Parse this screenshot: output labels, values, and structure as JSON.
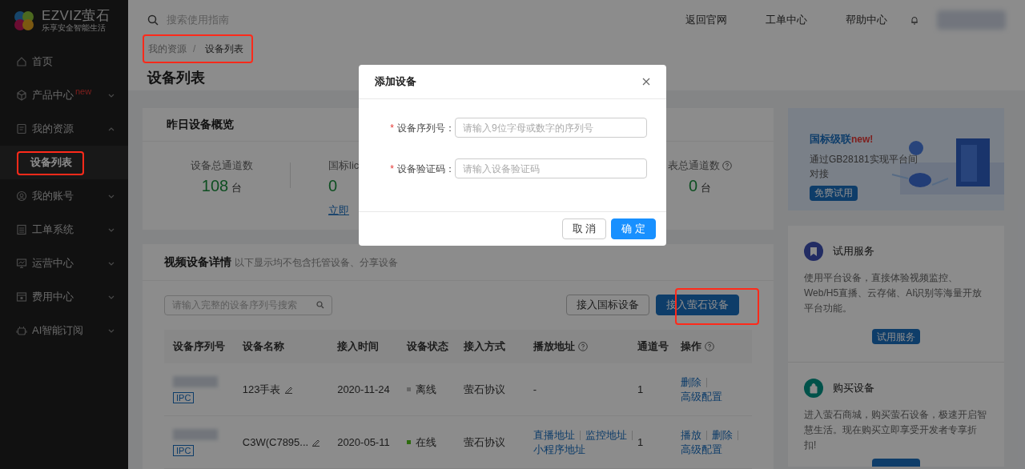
{
  "logo": {
    "brand": "EZVIZ萤石",
    "tagline": "乐享安全智能生活"
  },
  "sidebar": {
    "items": [
      {
        "label": "首页"
      },
      {
        "label": "产品中心",
        "badge": "new",
        "expanded": false
      },
      {
        "label": "我的资源",
        "expanded": true,
        "children": [
          {
            "label": "设备列表",
            "selected": true
          }
        ]
      },
      {
        "label": "我的账号",
        "expanded": false
      },
      {
        "label": "工单系统",
        "expanded": false
      },
      {
        "label": "运营中心",
        "expanded": false
      },
      {
        "label": "费用中心",
        "expanded": false
      },
      {
        "label": "AI智能订阅",
        "expanded": false
      }
    ]
  },
  "header": {
    "search_placeholder": "搜索使用指南",
    "links": [
      "返回官网",
      "工单中心",
      "帮助中心"
    ]
  },
  "breadcrumb": {
    "items": [
      "我的资源",
      "设备列表"
    ],
    "separator": "/"
  },
  "page_title": "设备列表",
  "overview": {
    "title": "昨日设备概览",
    "stats": [
      {
        "label": "设备总通道数",
        "value": "108",
        "unit": "台"
      },
      {
        "label": "国标lic",
        "value": "0",
        "link": "立即"
      },
      {
        "label": "表总通道数",
        "value": "0",
        "unit": "台",
        "help": true
      }
    ]
  },
  "banner": {
    "title": "国标级联",
    "badge": "new!",
    "text": "通过GB28181实现平台间对接",
    "button": "免费试用"
  },
  "promos": [
    {
      "title": "试用服务",
      "text": "使用平台设备，直接体验视频监控、Web/H5直播、云存储、AI识别等海量开放平台功能。",
      "button": "试用服务"
    },
    {
      "title": "购买设备",
      "text": "进入萤石商城，购买萤石设备，极速开启智慧生活。现在购买立即享受开发者专享折扣!"
    }
  ],
  "details": {
    "title": "视频设备详情",
    "note": "以下显示均不包含托管设备、分享设备",
    "search_placeholder": "请输入完整的设备序列号搜索",
    "buttons": [
      {
        "label": "接入国标设备",
        "primary": false
      },
      {
        "label": "接入萤石设备",
        "primary": true
      }
    ],
    "columns": [
      {
        "label": "设备序列号"
      },
      {
        "label": "设备名称"
      },
      {
        "label": "接入时间"
      },
      {
        "label": "设备状态"
      },
      {
        "label": "接入方式"
      },
      {
        "label": "播放地址",
        "help": true
      },
      {
        "label": "通道号"
      },
      {
        "label": "操作",
        "help": true
      }
    ],
    "rows": [
      {
        "tag": "IPC",
        "name": "123手表",
        "date": "2020-11-24",
        "status": "离线",
        "online": false,
        "method": "萤石协议",
        "addresses": [],
        "address_empty": "-",
        "channel": "1",
        "actions": [
          "删除",
          "高级配置"
        ]
      },
      {
        "tag": "IPC",
        "name": "C3W(C7895...",
        "date": "2020-05-11",
        "status": "在线",
        "online": true,
        "method": "萤石协议",
        "addresses": [
          "直播地址",
          "监控地址",
          "小程序地址"
        ],
        "channel": "1",
        "actions": [
          "播放",
          "删除",
          "高级配置"
        ]
      }
    ]
  },
  "dialog": {
    "title": "添加设备",
    "fields": [
      {
        "label": "设备序列号：",
        "placeholder": "请输入9位字母或数字的序列号",
        "marker": "*"
      },
      {
        "label": "设备验证码：",
        "placeholder": "请输入设备验证码",
        "marker": "*"
      }
    ],
    "buttons": [
      {
        "label": "取 消",
        "primary": false
      },
      {
        "label": "确 定",
        "primary": true
      }
    ]
  }
}
